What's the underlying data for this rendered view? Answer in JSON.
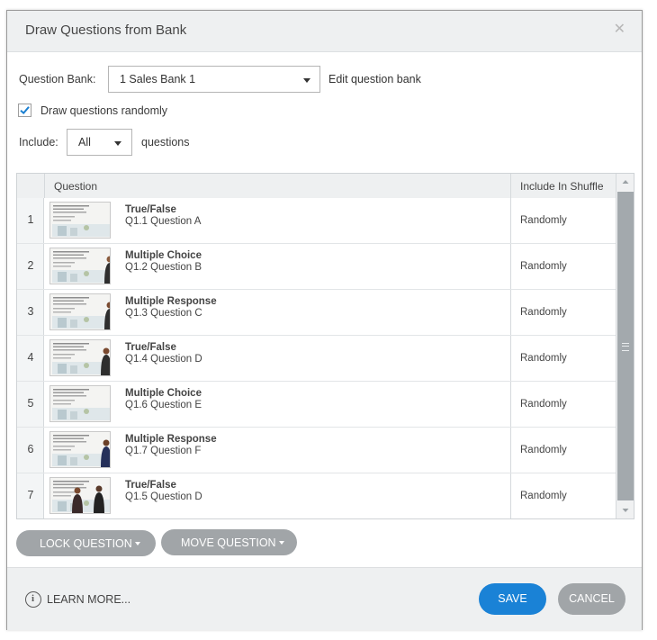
{
  "dialog": {
    "title": "Draw Questions from Bank",
    "close_icon": "close-icon"
  },
  "form": {
    "bank_label": "Question Bank:",
    "bank_value": "1 Sales Bank 1",
    "edit_link": "Edit question bank",
    "random_label": "Draw questions randomly",
    "random_checked": true,
    "include_label": "Include:",
    "include_value": "All",
    "include_suffix": "questions"
  },
  "grid": {
    "headers": {
      "question": "Question",
      "shuffle": "Include In Shuffle"
    },
    "rows": [
      {
        "num": "1",
        "type": "True/False",
        "name": "Q1.1 Question A",
        "shuffle": "Randomly"
      },
      {
        "num": "2",
        "type": "Multiple Choice",
        "name": "Q1.2 Question B",
        "shuffle": "Randomly"
      },
      {
        "num": "3",
        "type": "Multiple Response",
        "name": "Q1.3 Question C",
        "shuffle": "Randomly"
      },
      {
        "num": "4",
        "type": "True/False",
        "name": "Q1.4 Question D",
        "shuffle": "Randomly"
      },
      {
        "num": "5",
        "type": "Multiple Choice",
        "name": "Q1.6 Question E",
        "shuffle": "Randomly"
      },
      {
        "num": "6",
        "type": "Multiple Response",
        "name": "Q1.7 Question F",
        "shuffle": "Randomly"
      },
      {
        "num": "7",
        "type": "True/False",
        "name": "Q1.5 Question D",
        "shuffle": "Randomly"
      }
    ]
  },
  "actions": {
    "lock": "LOCK QUESTION",
    "move": "MOVE QUESTION"
  },
  "footer": {
    "learn_more": "LEARN MORE...",
    "save": "SAVE",
    "cancel": "CANCEL"
  },
  "colors": {
    "save": "#1a82d6",
    "cancel": "#a1a5a8",
    "pill": "#a1a5a8",
    "check": "#1a7fd1"
  }
}
